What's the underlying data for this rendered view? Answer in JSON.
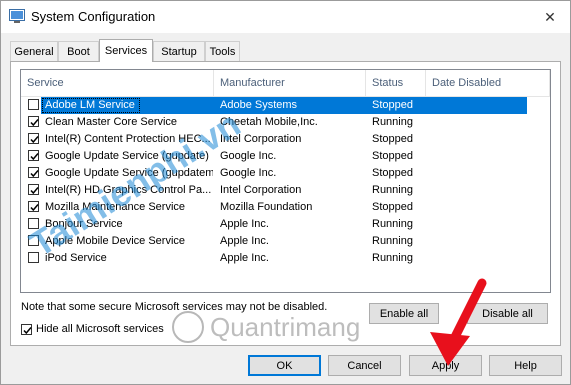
{
  "window": {
    "title": "System Configuration",
    "close_glyph": "✕"
  },
  "tabs": [
    {
      "label": "General"
    },
    {
      "label": "Boot"
    },
    {
      "label": "Services"
    },
    {
      "label": "Startup"
    },
    {
      "label": "Tools"
    }
  ],
  "table": {
    "headers": [
      "Service",
      "Manufacturer",
      "Status",
      "Date Disabled"
    ],
    "rows": [
      {
        "checked": false,
        "service": "Adobe LM Service",
        "manufacturer": "Adobe Systems",
        "status": "Stopped",
        "date_disabled": "",
        "selected": true
      },
      {
        "checked": true,
        "service": "Clean Master Core Service",
        "manufacturer": "Cheetah Mobile,Inc.",
        "status": "Running",
        "date_disabled": ""
      },
      {
        "checked": true,
        "service": "Intel(R) Content Protection HEC...",
        "manufacturer": "Intel Corporation",
        "status": "Stopped",
        "date_disabled": ""
      },
      {
        "checked": true,
        "service": "Google Update Service (gupdate)",
        "manufacturer": "Google Inc.",
        "status": "Stopped",
        "date_disabled": ""
      },
      {
        "checked": true,
        "service": "Google Update Service (gupdatem)",
        "manufacturer": "Google Inc.",
        "status": "Stopped",
        "date_disabled": ""
      },
      {
        "checked": true,
        "service": "Intel(R) HD Graphics Control Pa...",
        "manufacturer": "Intel Corporation",
        "status": "Running",
        "date_disabled": ""
      },
      {
        "checked": true,
        "service": "Mozilla Maintenance Service",
        "manufacturer": "Mozilla Foundation",
        "status": "Stopped",
        "date_disabled": ""
      },
      {
        "checked": false,
        "service": "Bonjour Service",
        "manufacturer": "Apple Inc.",
        "status": "Running",
        "date_disabled": ""
      },
      {
        "checked": false,
        "service": "Apple Mobile Device Service",
        "manufacturer": "Apple Inc.",
        "status": "Running",
        "date_disabled": ""
      },
      {
        "checked": false,
        "service": "iPod Service",
        "manufacturer": "Apple Inc.",
        "status": "Running",
        "date_disabled": ""
      }
    ]
  },
  "note": "Note that some secure Microsoft services may not be disabled.",
  "buttons": {
    "enable_all": "Enable all",
    "disable_all": "Disable all",
    "ok": "OK",
    "cancel": "Cancel",
    "apply": "Apply",
    "help": "Help"
  },
  "hide_ms": {
    "label": "Hide all Microsoft services",
    "checked": true
  },
  "watermark": {
    "top": "Taimienphi.vn",
    "bottom": "Quantrimang"
  },
  "colors": {
    "selection": "#0078d7",
    "header_text": "#4c607a",
    "arrow": "#e8101c",
    "watermark_top": "#1e8ad6",
    "watermark_bottom": "#a7a7a7"
  }
}
